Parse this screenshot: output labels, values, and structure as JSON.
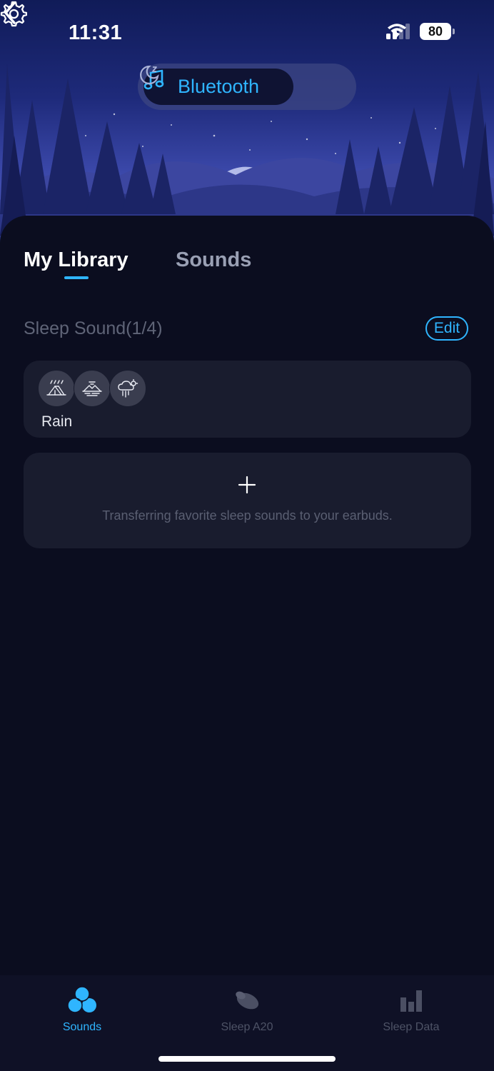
{
  "status_bar": {
    "time": "11:31",
    "battery": "80"
  },
  "header": {
    "mode_label": "Bluetooth"
  },
  "tabs": [
    {
      "label": "My Library",
      "active": true
    },
    {
      "label": "Sounds",
      "active": false
    }
  ],
  "library": {
    "section_title": "Sleep Sound(1/4)",
    "edit_label": "Edit",
    "items": [
      {
        "name": "Rain",
        "icons": [
          "tent-rain-icon",
          "mountain-lake-icon",
          "cloud-sun-rain-icon"
        ]
      }
    ],
    "add_hint": "Transferring favorite sleep sounds to your earbuds."
  },
  "bottom_nav": [
    {
      "label": "Sounds",
      "active": true
    },
    {
      "label": "Sleep A20",
      "active": false
    },
    {
      "label": "Sleep Data",
      "active": false
    }
  ],
  "colors": {
    "accent": "#2fb5ff",
    "background": "#0b0d1f",
    "card": "#191c2e"
  }
}
